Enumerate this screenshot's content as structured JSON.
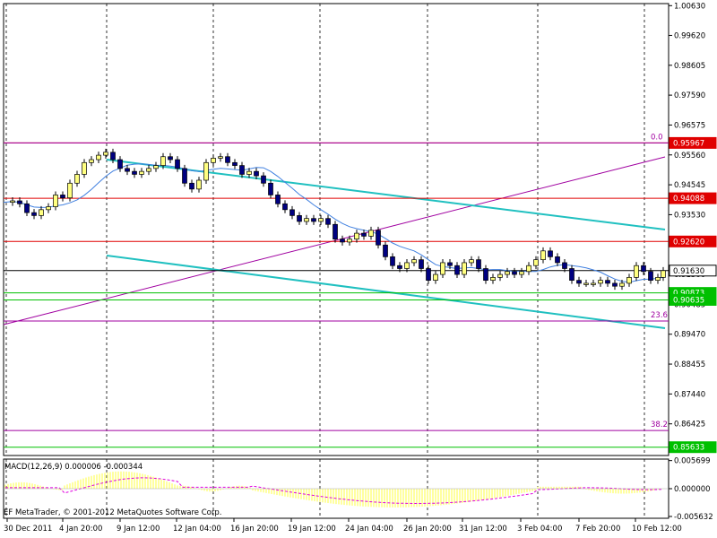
{
  "chart_data": {
    "type": "candlestick",
    "main_panel": {
      "y_range": [
        0.8535,
        1.007
      ],
      "y_ticks": [
        {
          "value": 1.0063,
          "label": "1.00630"
        },
        {
          "value": 0.9962,
          "label": "0.99620"
        },
        {
          "value": 0.98605,
          "label": "0.98605"
        },
        {
          "value": 0.9759,
          "label": "0.97590"
        },
        {
          "value": 0.96575,
          "label": "0.96575"
        },
        {
          "value": 0.9556,
          "label": "0.95560"
        },
        {
          "value": 0.94545,
          "label": "0.94545"
        },
        {
          "value": 0.9353,
          "label": "0.93530"
        },
        {
          "value": 0.92515,
          "label": "0.92515"
        },
        {
          "value": 0.915,
          "label": "0.91500"
        },
        {
          "value": 0.90485,
          "label": "0.90485"
        },
        {
          "value": 0.8947,
          "label": "0.89470"
        },
        {
          "value": 0.88455,
          "label": "0.88455"
        },
        {
          "value": 0.8744,
          "label": "0.87440"
        },
        {
          "value": 0.86425,
          "label": "0.86425"
        }
      ],
      "levels": [
        {
          "value": 0.95967,
          "label": "0.95967",
          "kind": "red"
        },
        {
          "value": 0.94088,
          "label": "0.94088",
          "kind": "red"
        },
        {
          "value": 0.9262,
          "label": "0.92620",
          "kind": "red"
        },
        {
          "value": 0.9163,
          "label": "0.91630",
          "kind": "current"
        },
        {
          "value": 0.90873,
          "label": "0.90873",
          "kind": "green"
        },
        {
          "value": 0.90635,
          "label": "0.90635",
          "kind": "green"
        },
        {
          "value": 0.85633,
          "label": "0.85633",
          "kind": "green"
        }
      ],
      "fib_levels": [
        {
          "value": 0.95967,
          "label": "0.0"
        },
        {
          "value": 0.8992,
          "label": "23.6"
        },
        {
          "value": 0.862,
          "label": "38.2"
        }
      ]
    },
    "macd_panel": {
      "title": "MACD(12,26,9) 0.000006 -0.000344",
      "y_ticks": [
        {
          "value": 0.005699,
          "label": "0.005699"
        },
        {
          "value": 0.0,
          "label": "0.000000"
        },
        {
          "value": -0.005632,
          "label": "-0.005632"
        }
      ]
    },
    "x_labels": [
      "30 Dec 2011",
      "4 Jan 20:00",
      "9 Jan 12:00",
      "12 Jan 04:00",
      "16 Jan 20:00",
      "19 Jan 12:00",
      "24 Jan 04:00",
      "26 Jan 20:00",
      "31 Jan 12:00",
      "3 Feb 04:00",
      "7 Feb 20:00",
      "10 Feb 12:00"
    ],
    "copyright": "EF MetaTrader, © 2001-2012 MetaQuotes Software Corp.",
    "colors": {
      "bull_body": "#ffff80",
      "bear_body": "#000080",
      "red_level": "#e00000",
      "green_level": "#00c000",
      "fib": "#a000a0",
      "channel": "#20c0c0",
      "ma": "#4080e0",
      "macd_hist": "#ffff80",
      "macd_signal": "#e000e0"
    }
  }
}
